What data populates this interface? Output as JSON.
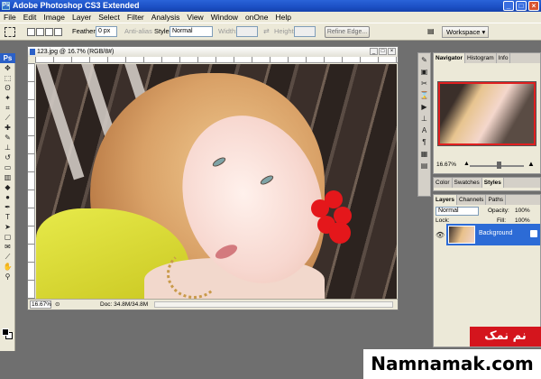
{
  "window": {
    "title": "Adobe Photoshop CS3 Extended",
    "app_icon": "Ps"
  },
  "menu": [
    "File",
    "Edit",
    "Image",
    "Layer",
    "Select",
    "Filter",
    "Analysis",
    "View",
    "Window",
    "onOne",
    "Help"
  ],
  "options_bar": {
    "feather_label": "Feather:",
    "feather_value": "0 px",
    "anti_alias_label": "Anti-alias",
    "style_label": "Style:",
    "style_value": "Normal",
    "width_label": "Width:",
    "height_label": "Height:",
    "refine_edge_label": "Refine Edge...",
    "workspace_label": "Workspace ▾"
  },
  "tools_panel": {
    "header": "Ps",
    "tools": [
      "move-icon",
      "marquee-icon",
      "lasso-icon",
      "magic-wand-icon",
      "crop-icon",
      "slice-icon",
      "healing-icon",
      "brush-icon",
      "clone-stamp-icon",
      "history-brush-icon",
      "eraser-icon",
      "gradient-icon",
      "blur-icon",
      "dodge-icon",
      "pen-icon",
      "type-icon",
      "path-select-icon",
      "shape-icon",
      "notes-icon",
      "eyedropper-icon",
      "hand-icon",
      "zoom-icon"
    ]
  },
  "document": {
    "title": "123.jpg @ 16.7% (RGB/8#)",
    "zoom": "16.67%",
    "doc_info": "Doc: 34.8M/34.8M"
  },
  "navigator_panel": {
    "tabs": [
      "Navigator",
      "Histogram",
      "Info"
    ],
    "zoom": "16.67%"
  },
  "styles_panel": {
    "tabs": [
      "Color",
      "Swatches",
      "Styles"
    ],
    "swatch_colors": [
      "#ffffff",
      "#d02020",
      "#2060d0",
      "#20a040",
      "#e0c020",
      "#9040c0",
      "#e07020",
      "#606060",
      "#f0f0f0",
      "#a04040",
      "#4080e0",
      "#60c060",
      "#c0a040",
      "#c080e0",
      "#f0a060",
      "#202020"
    ]
  },
  "layers_panel": {
    "tabs": [
      "Layers",
      "Channels",
      "Paths"
    ],
    "blend_mode": "Normal",
    "opacity_label": "Opacity:",
    "opacity_value": "100%",
    "lock_label": "Lock:",
    "fill_label": "Fill:",
    "fill_value": "100%",
    "layer_name": "Background"
  },
  "watermark": {
    "persian": "نم نمک",
    "site": "Namnamak.com"
  }
}
